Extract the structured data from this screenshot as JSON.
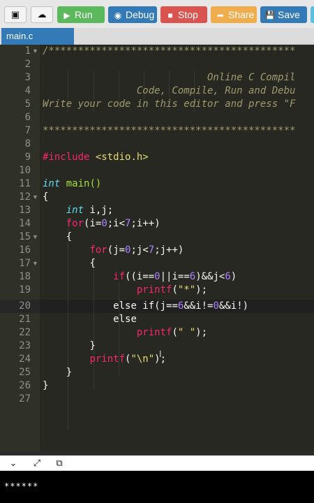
{
  "toolbar": {
    "new_file_icon": "file-icon",
    "upload_icon": "upload-icon",
    "run_label": "Run",
    "debug_label": "Debug",
    "stop_label": "Stop",
    "share_label": "Share",
    "save_label": "Save",
    "colors": {
      "run": "#5cb85c",
      "debug": "#337ab7",
      "stop": "#d9534f",
      "share": "#f0ad4e",
      "save": "#337ab7"
    }
  },
  "tabs": [
    {
      "label": "main.c",
      "active": true
    }
  ],
  "editor": {
    "line_numbers": [
      "1",
      "2",
      "3",
      "4",
      "5",
      "6",
      "7",
      "8",
      "9",
      "10",
      "11",
      "12",
      "13",
      "14",
      "15",
      "16",
      "17",
      "18",
      "19",
      "20",
      "21",
      "22",
      "23",
      "24",
      "25",
      "26",
      "27"
    ],
    "active_line": 20,
    "code": {
      "l1": "/******************************************",
      "l3": "                            Online C Compil",
      "l4": "                Code, Compile, Run and Debu",
      "l5": "Write your code in this editor and press \"F",
      "l7": "*******************************************",
      "l9_kw": "#include",
      "l9_rest": " <stdio.h>",
      "l11_type": "int",
      "l11_rest": " main()",
      "l12": "{",
      "l13_type": "int",
      "l13_rest": " i,j;",
      "l14_kw": "for",
      "l14_a": "(i=",
      "l14_n0": "0",
      "l14_b": ";i<",
      "l14_n7": "7",
      "l14_c": ";i++)",
      "l15": "{",
      "l16_kw": "for",
      "l16_a": "(j=",
      "l16_n0": "0",
      "l16_b": ";j<",
      "l16_n7": "7",
      "l16_c": ";j++)",
      "l17": "{",
      "l18_kw": "if",
      "l18_a": "((i==",
      "l18_n0": "0",
      "l18_b": "||i==",
      "l18_n6": "6",
      "l18_c": ")&&j<",
      "l18_n6b": "6",
      "l18_d": ")",
      "l19_fn": "printf",
      "l19_a": "(",
      "l19_str": "\"*\"",
      "l19_b": ");",
      "l20_kw": "else if",
      "l20_a": "(j==",
      "l20_n6": "6",
      "l20_b": "&&i!=",
      "l20_n0": "0",
      "l20_c": "&&i!)",
      "l21_kw": "else",
      "l22_fn": "printf",
      "l22_a": "(",
      "l22_str": "\" \"",
      "l22_b": ");",
      "l23": "}",
      "l24_fn": "printf",
      "l24_a": "(",
      "l24_str": "\"\\n\"",
      "l24_b": ");",
      "l25": "}",
      "l26": "}"
    }
  },
  "output": {
    "collapse_icon": "chevron-down-icon",
    "expand_icon": "expand-icon",
    "copy_icon": "copy-icon",
    "console_text": "******"
  }
}
